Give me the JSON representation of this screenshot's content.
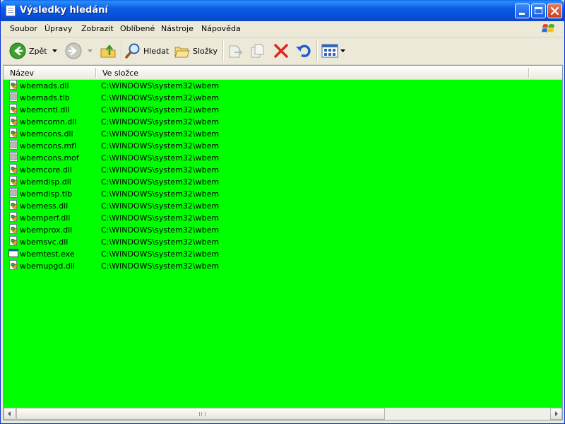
{
  "window": {
    "title": "Výsledky hledání"
  },
  "menu": [
    "Soubor",
    "Úpravy",
    "Zobrazit",
    "Oblíbené",
    "Nástroje",
    "Nápověda"
  ],
  "toolbar": {
    "back_label": "Zpět",
    "search_label": "Hledat",
    "folders_label": "Složky"
  },
  "columns": {
    "name": "Název",
    "folder": "Ve složce"
  },
  "files": [
    {
      "name": "wbemads.dll",
      "folder": "C:\\WINDOWS\\system32\\wbem",
      "icon": "dll-icon"
    },
    {
      "name": "wbemads.tlb",
      "folder": "C:\\WINDOWS\\system32\\wbem",
      "icon": "tlb-icon"
    },
    {
      "name": "wbemcntl.dll",
      "folder": "C:\\WINDOWS\\system32\\wbem",
      "icon": "dll-icon"
    },
    {
      "name": "wbemcomn.dll",
      "folder": "C:\\WINDOWS\\system32\\wbem",
      "icon": "dll-icon"
    },
    {
      "name": "wbemcons.dll",
      "folder": "C:\\WINDOWS\\system32\\wbem",
      "icon": "dll-icon"
    },
    {
      "name": "wbemcons.mfl",
      "folder": "C:\\WINDOWS\\system32\\wbem",
      "icon": "tlb-icon"
    },
    {
      "name": "wbemcons.mof",
      "folder": "C:\\WINDOWS\\system32\\wbem",
      "icon": "tlb-icon"
    },
    {
      "name": "wbemcore.dll",
      "folder": "C:\\WINDOWS\\system32\\wbem",
      "icon": "dll-icon"
    },
    {
      "name": "wbemdisp.dll",
      "folder": "C:\\WINDOWS\\system32\\wbem",
      "icon": "dll-icon"
    },
    {
      "name": "wbemdisp.tlb",
      "folder": "C:\\WINDOWS\\system32\\wbem",
      "icon": "tlb-icon"
    },
    {
      "name": "wbemess.dll",
      "folder": "C:\\WINDOWS\\system32\\wbem",
      "icon": "dll-icon"
    },
    {
      "name": "wbemperf.dll",
      "folder": "C:\\WINDOWS\\system32\\wbem",
      "icon": "dll-icon"
    },
    {
      "name": "wbemprox.dll",
      "folder": "C:\\WINDOWS\\system32\\wbem",
      "icon": "dll-icon"
    },
    {
      "name": "wbemsvc.dll",
      "folder": "C:\\WINDOWS\\system32\\wbem",
      "icon": "dll-icon"
    },
    {
      "name": "wbemtest.exe",
      "folder": "C:\\WINDOWS\\system32\\wbem",
      "icon": "exe-icon"
    },
    {
      "name": "wbemupgd.dll",
      "folder": "C:\\WINDOWS\\system32\\wbem",
      "icon": "dll-icon"
    }
  ],
  "colors": {
    "list_background": "#00ff00",
    "titlebar": "#0753d9"
  }
}
